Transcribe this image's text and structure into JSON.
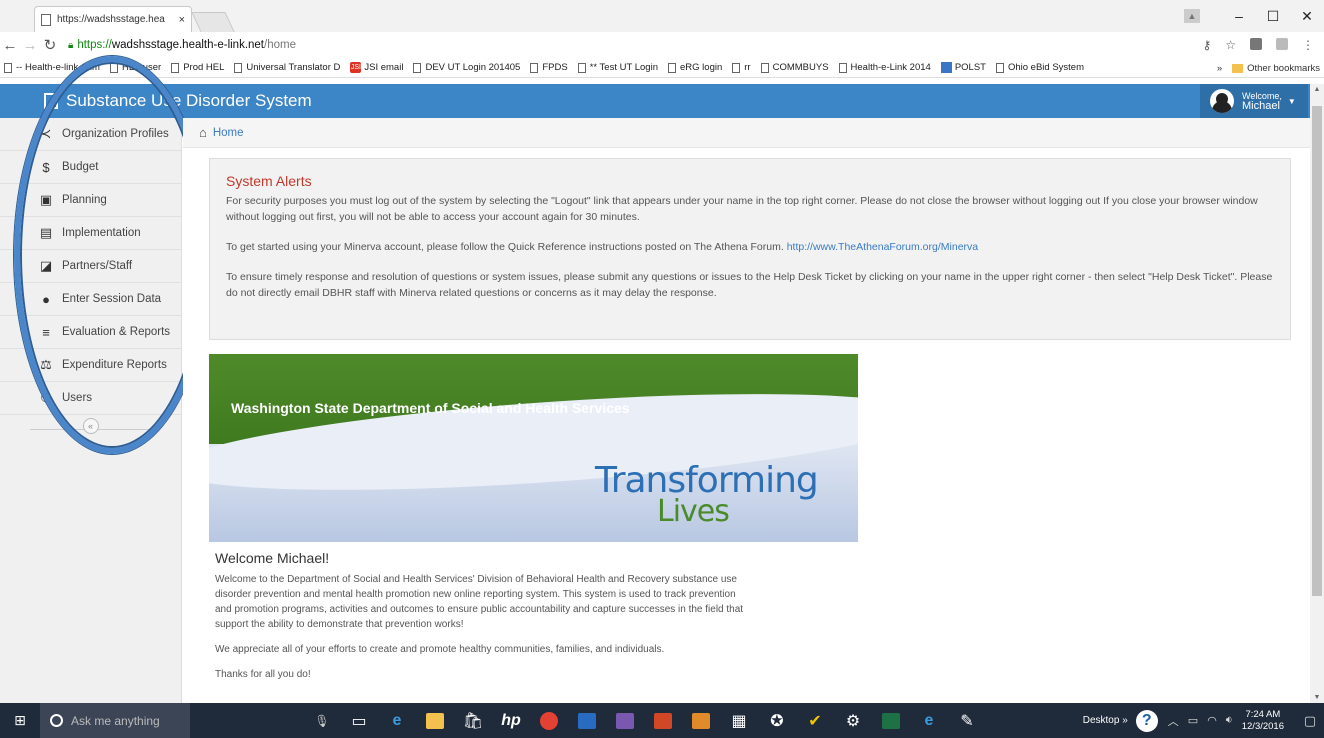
{
  "browser": {
    "tab_title": "https://wadshsstage.hea",
    "tab_close": "×",
    "url_scheme": "https://",
    "url_host": "wadshsstage.health-e-link.net",
    "url_path": "/home",
    "window_controls": [
      "–",
      "☐",
      "✕"
    ],
    "bookmarks": [
      {
        "label": "-- Health-e-link Adm",
        "icon": "doc-icon"
      },
      {
        "label": "HEL user",
        "icon": "doc-icon"
      },
      {
        "label": "Prod HEL",
        "icon": "doc-icon"
      },
      {
        "label": "Universal Translator D",
        "icon": "doc-icon"
      },
      {
        "label": "JSI email",
        "icon": "jsi-icon"
      },
      {
        "label": "DEV UT Login 201405",
        "icon": "doc-icon"
      },
      {
        "label": "FPDS",
        "icon": "doc-icon"
      },
      {
        "label": "** Test UT Login",
        "icon": "doc-icon"
      },
      {
        "label": "eRG login",
        "icon": "doc-icon"
      },
      {
        "label": "rr",
        "icon": "doc-icon"
      },
      {
        "label": "COMMBUYS",
        "icon": "doc-icon"
      },
      {
        "label": "Health-e-Link 2014",
        "icon": "doc-icon"
      },
      {
        "label": "POLST",
        "icon": "polst-icon"
      },
      {
        "label": "Ohio eBid System",
        "icon": "doc-icon"
      }
    ],
    "bookmarks_overflow": "»",
    "other_bookmarks": "Other bookmarks"
  },
  "app": {
    "title": "Substance Use Disorder System",
    "welcome_label": "Welcome,",
    "user_name": "Michael",
    "header_color": "#3c85c6"
  },
  "sidebar": {
    "items": [
      {
        "label": "Organization Profiles",
        "icon": "share-icon",
        "glyph": "≺"
      },
      {
        "label": "Budget",
        "icon": "dollar-icon",
        "glyph": "$"
      },
      {
        "label": "Planning",
        "icon": "copy-icon",
        "glyph": "▣"
      },
      {
        "label": "Implementation",
        "icon": "list-icon",
        "glyph": "▤"
      },
      {
        "label": "Partners/Staff",
        "icon": "share-square-icon",
        "glyph": "◪"
      },
      {
        "label": "Enter Session Data",
        "icon": "user-icon",
        "glyph": "●"
      },
      {
        "label": "Evaluation & Reports",
        "icon": "bars-icon",
        "glyph": "≡"
      },
      {
        "label": "Expenditure Reports",
        "icon": "balance-icon",
        "glyph": "⚖"
      },
      {
        "label": "Users",
        "icon": "users-icon",
        "glyph": "⚇"
      }
    ],
    "collapse_glyph": "«"
  },
  "breadcrumb": {
    "home": "Home"
  },
  "alerts": {
    "title": "System Alerts",
    "p1": "For security purposes you must log out of the system by selecting the \"Logout\" link that appears under your name in the top right corner. Please do not close the browser without logging out If you close your browser window without logging out first, you will not be able to access your account again for 30 minutes.",
    "p2_text": "To get started using your Minerva account, please follow the Quick Reference instructions posted on The Athena Forum. ",
    "p2_link": "http://www.TheAthenaForum.org/Minerva",
    "p3": "To ensure timely response and resolution of questions or system issues, please submit any questions or issues to the Help Desk Ticket by clicking on your name in the upper right corner - then select \"Help Desk Ticket\". Please do not directly email DBHR staff with Minerva related questions or concerns as it may delay the response."
  },
  "banner": {
    "dept": "Washington State Department of Social and Health Services",
    "line1": "Transforming",
    "line2": "Lives"
  },
  "welcome": {
    "heading": "Welcome Michael!",
    "p1": "Welcome to the Department of Social and Health Services' Division of Behavioral Health and Recovery substance use disorder prevention and mental health promotion new online reporting system. This system is used to track prevention and promotion programs, activities and outcomes to ensure public accountability and capture successes in the field that support the ability to demonstrate that prevention works!",
    "p2": "We appreciate all of your efforts to create and promote healthy communities, families, and individuals.",
    "p3": "Thanks for all you do!"
  },
  "taskbar": {
    "search_placeholder": "Ask me anything",
    "desktop_label": "Desktop",
    "overflow": "»",
    "time": "7:24 AM",
    "date": "12/3/2016"
  }
}
